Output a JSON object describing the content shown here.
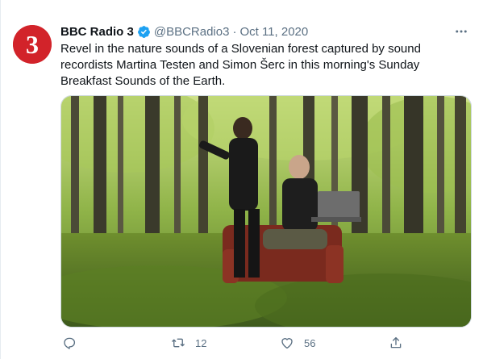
{
  "tweet": {
    "display_name": "BBC Radio 3",
    "verified": true,
    "handle": "@BBCRadio3",
    "separator": "·",
    "date": "Oct 11, 2020",
    "text": "Revel in the nature sounds of a Slovenian forest captured by sound recordists Martina Testen and Simon Šerc in this morning's Sunday Breakfast Sounds of the Earth.",
    "avatar_logo": "3",
    "avatar_color": "#d2232a",
    "accent_color": "#1da1f2"
  },
  "actions": {
    "reply_count": "",
    "retweet_count": "12",
    "like_count": "56",
    "share_count": ""
  },
  "icons": {
    "reply": "reply-icon",
    "retweet": "retweet-icon",
    "like": "heart-icon",
    "share": "share-icon",
    "more": "more-icon",
    "verified": "verified-badge-icon"
  }
}
